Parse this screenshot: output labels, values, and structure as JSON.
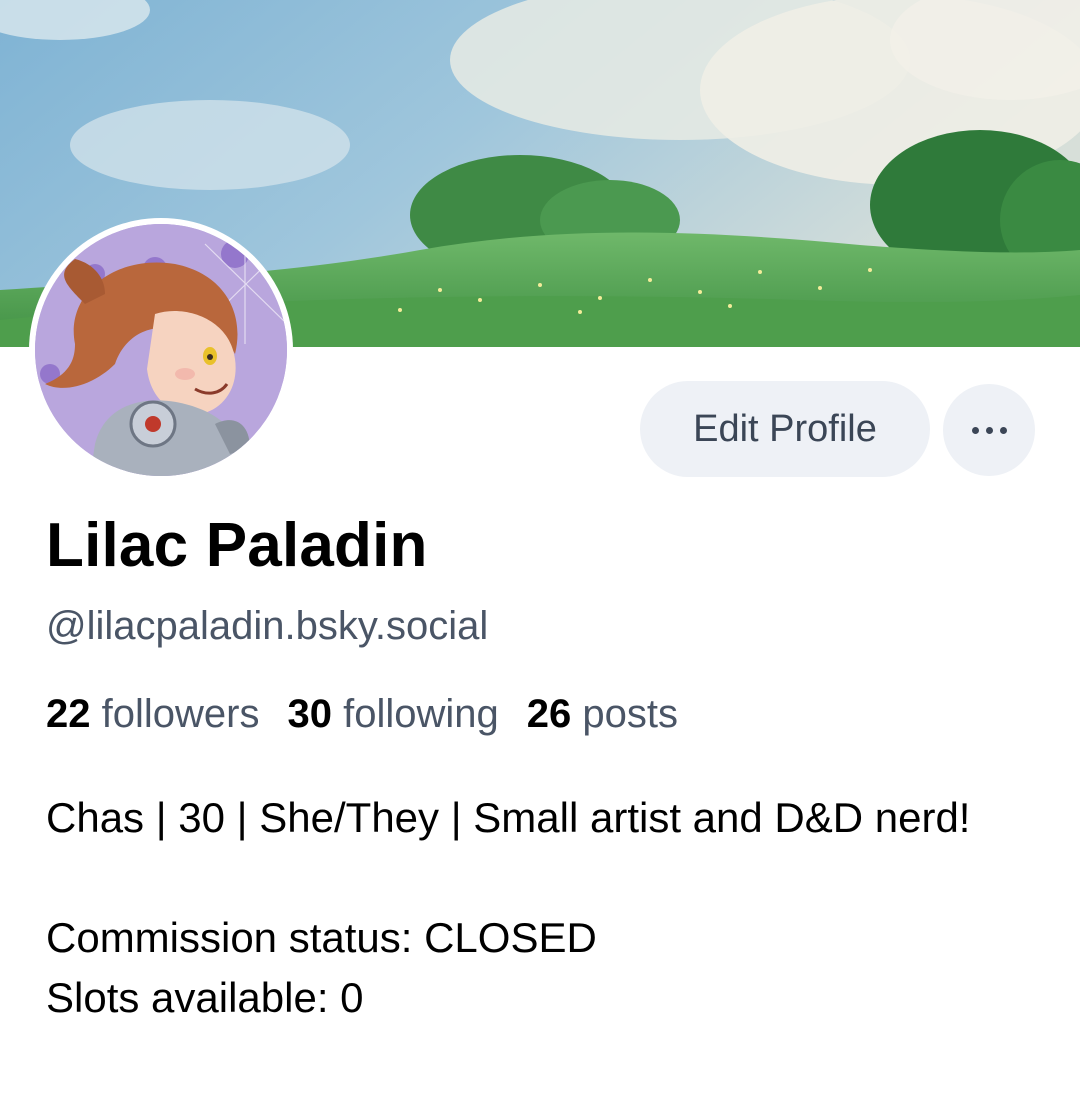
{
  "profile": {
    "display_name": "Lilac Paladin",
    "handle": "@lilacpaladin.bsky.social",
    "edit_button_label": "Edit Profile",
    "more_button_icon": "more-horizontal-icon",
    "stats": {
      "followers_count": "22",
      "followers_label": "followers",
      "following_count": "30",
      "following_label": "following",
      "posts_count": "26",
      "posts_label": "posts"
    },
    "bio": {
      "line1": "Chas | 30 | She/They | Small artist and D&D nerd!",
      "line2": "Commission status: CLOSED",
      "line3": "Slots available: 0"
    }
  },
  "colors": {
    "button_bg": "#eef1f6",
    "muted_text": "#4a5566",
    "avatar_bg": "#b9a6dd"
  }
}
